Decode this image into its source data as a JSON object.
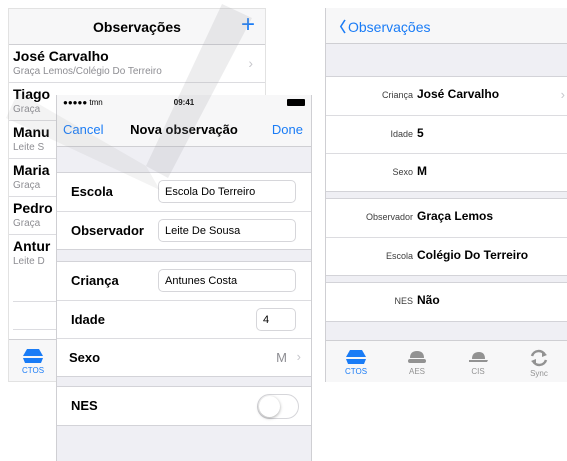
{
  "list": {
    "title": "Observações",
    "add_label": "+",
    "items": [
      {
        "name": "José Carvalho",
        "sub": "Graça Lemos/Colégio Do Terreiro"
      },
      {
        "name": "Tiago",
        "sub": "Graça"
      },
      {
        "name": "Manu",
        "sub": "Leite S"
      },
      {
        "name": "Maria",
        "sub": "Graça"
      },
      {
        "name": "Pedro",
        "sub": "Graça"
      },
      {
        "name": "Antur",
        "sub": "Leite D"
      }
    ],
    "tab_label": "CTOS"
  },
  "modal": {
    "status": {
      "carrier": "●●●●● tmn",
      "time": "09:41"
    },
    "cancel_label": "Cancel",
    "title": "Nova observação",
    "done_label": "Done",
    "fields": {
      "escola": {
        "label": "Escola",
        "value": "Escola Do Terreiro"
      },
      "observador": {
        "label": "Observador",
        "value": "Leite De Sousa"
      },
      "crianca": {
        "label": "Criança",
        "value": "Antunes Costa"
      },
      "idade": {
        "label": "Idade",
        "value": "4"
      },
      "sexo": {
        "label": "Sexo",
        "value": "M"
      },
      "nes": {
        "label": "NES",
        "enabled": false
      }
    }
  },
  "detail": {
    "back_label": "Observações",
    "rows": {
      "crianca": {
        "label": "Criança",
        "value": "José Carvalho"
      },
      "idade": {
        "label": "Idade",
        "value": "5"
      },
      "sexo": {
        "label": "Sexo",
        "value": "M"
      },
      "observador": {
        "label": "Observador",
        "value": "Graça Lemos"
      },
      "escola": {
        "label": "Escola",
        "value": "Colégio Do Terreiro"
      },
      "nes": {
        "label": "NES",
        "value": "Não"
      }
    },
    "tabs": [
      {
        "label": "CTOS",
        "icon": "ctos-icon",
        "active": true
      },
      {
        "label": "AES",
        "icon": "aes-icon",
        "active": false
      },
      {
        "label": "CIS",
        "icon": "cis-icon",
        "active": false
      },
      {
        "label": "Sync",
        "icon": "sync-icon",
        "active": false
      }
    ]
  },
  "colors": {
    "accent": "#1a7cf6",
    "inactive": "#929292",
    "background": "#efeff4"
  }
}
